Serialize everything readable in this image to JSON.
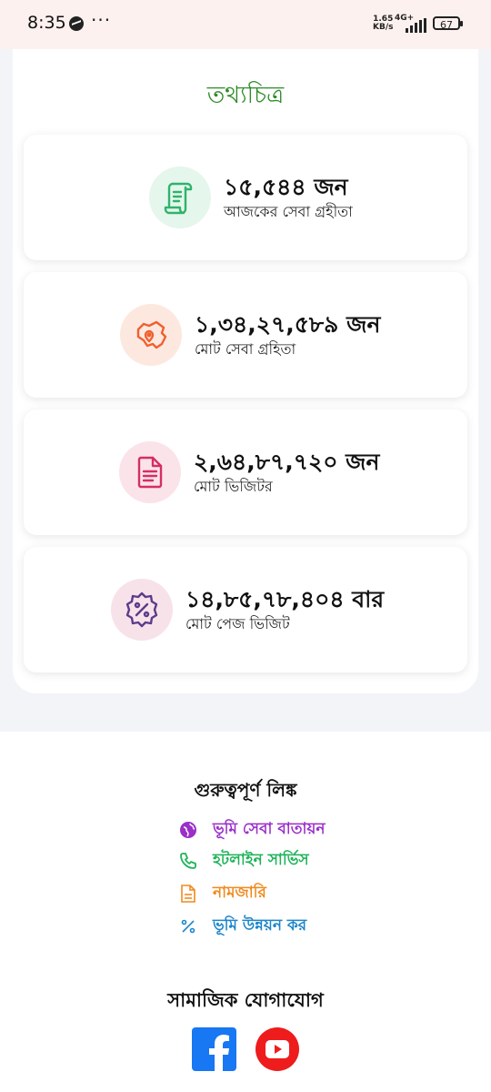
{
  "status_bar": {
    "time": "8:35",
    "speed_value": "1.65",
    "speed_unit": "KB/s",
    "network": "4G+",
    "battery": "67"
  },
  "infographic": {
    "title": "তথ্যচিত্র",
    "cards": [
      {
        "value": "১৫,৫৪৪ জন",
        "label": "আজকের সেবা গ্রহীতা",
        "icon": "document-scroll-icon",
        "icon_color": "#2fb36b",
        "bg_color": "#e5f6ec"
      },
      {
        "value": "১,৩৪,২৭,৫৮৯ জন",
        "label": "মোট সেবা গ্রহিতা",
        "icon": "map-pin-icon",
        "icon_color": "#f0602e",
        "bg_color": "#fde8e0"
      },
      {
        "value": "২,৬৪,৮৭,৭২০ জন",
        "label": "মোট ভিজিটর",
        "icon": "document-icon",
        "icon_color": "#d42f62",
        "bg_color": "#fbe3ea"
      },
      {
        "value": "১৪,৮৫,৭৮,৪০৪ বার",
        "label": "মোট পেজ ভিজিট",
        "icon": "percent-badge-icon",
        "icon_color": "#5a3c8a",
        "bg_color": "#f8e2ea"
      }
    ]
  },
  "links": {
    "title": "গুরুত্বপূর্ণ লিঙ্ক",
    "items": [
      {
        "label": "ভূমি সেবা বাতায়ন",
        "icon": "globe-icon",
        "color": "#9b2fc9"
      },
      {
        "label": "হটলাইন সার্ভিস",
        "icon": "phone-icon",
        "color": "#1fb35a"
      },
      {
        "label": "নামজারি",
        "icon": "file-icon",
        "color": "#f08a1e"
      },
      {
        "label": "ভূমি উন্নয়ন কর",
        "icon": "percent-icon",
        "color": "#1e86c9"
      }
    ]
  },
  "social": {
    "title": "সামাজিক যোগাযোগ",
    "items": [
      {
        "name": "facebook",
        "icon": "facebook-icon",
        "color": "#1877f2"
      },
      {
        "name": "youtube",
        "icon": "youtube-icon",
        "color": "#ee1c1c"
      }
    ]
  }
}
